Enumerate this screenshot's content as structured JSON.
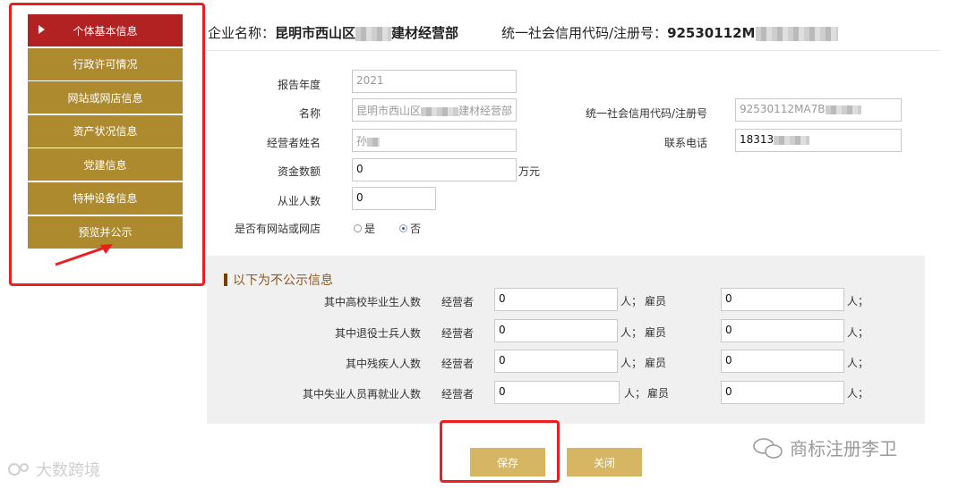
{
  "sidebar": {
    "items": [
      {
        "label": "个体基本信息"
      },
      {
        "label": "行政许可情况"
      },
      {
        "label": "网站或网店信息"
      },
      {
        "label": "资产状况信息"
      },
      {
        "label": "党建信息"
      },
      {
        "label": "特种设备信息"
      },
      {
        "label": "预览并公示"
      }
    ]
  },
  "header": {
    "company_label": "企业名称：",
    "company_prefix": "昆明市西山区",
    "company_suffix": "建材经营部",
    "code_label": "统一社会信用代码/注册号：",
    "code_prefix": "92530112M"
  },
  "form": {
    "report_year": {
      "label": "报告年度",
      "value": "2021"
    },
    "name": {
      "label": "名称",
      "value_prefix": "昆明市西山区",
      "value_suffix": "建材经营部"
    },
    "credit_code": {
      "label": "统一社会信用代码/注册号",
      "value_prefix": "92530112MA7B"
    },
    "operator": {
      "label": "经营者姓名",
      "value_prefix": "孙"
    },
    "phone": {
      "label": "联系电话",
      "value_prefix": "18313"
    },
    "capital": {
      "label": "资金数额",
      "value": "0",
      "unit": "万元"
    },
    "employees": {
      "label": "从业人数",
      "value": "0"
    },
    "has_website": {
      "label": "是否有网站或网店",
      "options": [
        "是",
        "否"
      ],
      "selected": "否"
    }
  },
  "nonpublic": {
    "title": "以下为不公示信息",
    "operator_label": "经营者",
    "unit_person": "人；",
    "employee_label": "雇员",
    "unit_end": "人；",
    "rows": [
      {
        "label": "其中高校毕业生人数",
        "operator": "0",
        "employee": "0"
      },
      {
        "label": "其中退役士兵人数",
        "operator": "0",
        "employee": "0"
      },
      {
        "label": "其中残疾人人数",
        "operator": "0",
        "employee": "0"
      },
      {
        "label": "其中失业人员再就业人数",
        "operator": "0",
        "employee": "0"
      }
    ]
  },
  "buttons": {
    "save": "保存",
    "close": "关闭"
  },
  "watermarks": {
    "left": "大数跨境",
    "right": "商标注册李卫"
  }
}
